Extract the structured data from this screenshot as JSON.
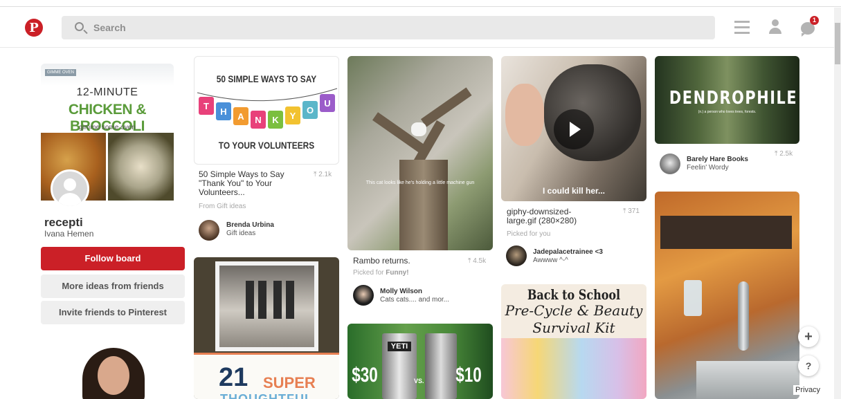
{
  "header": {
    "search_placeholder": "Search",
    "notification_count": "1"
  },
  "board": {
    "cover_badge": "GIMME OVEN",
    "cover_line1": "12-MINUTE",
    "cover_line2": "CHICKEN & BROCCOLI",
    "cover_line3": "gimme some oven",
    "title": "recepti",
    "owner": "Ivana Hemen",
    "follow_label": "Follow board",
    "more_label": "More ideas from friends",
    "invite_label": "Invite friends to Pinterest"
  },
  "pins": {
    "thanks": {
      "title_top": "50 SIMPLE WAYS TO SAY",
      "tags": [
        "T",
        "H",
        "A",
        "N",
        "K",
        "Y",
        "O",
        "U"
      ],
      "title_bottom": "TO YOUR VOLUNTEERS",
      "description": "50 Simple Ways to Say \"Thank You\" to Your Volunteers...",
      "count": "⤒ 2.1k",
      "source": "From Gift ideas",
      "user": "Brenda Urbina",
      "user_sub": "Gift ideas"
    },
    "candles": {
      "num": "21",
      "word1": "SUPER",
      "word2": "THOUGHTFUL"
    },
    "tree": {
      "caption": "This cat looks like he's holding a little machine gun",
      "description": "Rambo returns.",
      "count": "⤒ 4.5k",
      "picked_prefix": "Picked for ",
      "picked_topic": "Funny!",
      "user": "Molly Wilson",
      "user_sub": "Cats cats.... and mor..."
    },
    "yeti": {
      "price_left": "$30",
      "vs": "VS.",
      "price_right": "$10",
      "cup_label": "YETI"
    },
    "cat_video": {
      "caption": "I could kill her...",
      "description": "giphy-downsized-large.gif (280×280)",
      "count": "⤒ 371",
      "picked": "Picked for you",
      "user": "Jadepalacetrainee <3",
      "user_sub": "Awwww ^-^"
    },
    "school": {
      "line1": "Back to School",
      "line2": "Pre-Cycle & Beauty",
      "line3": "Survival Kit"
    },
    "forest": {
      "title": "DENDROPHILE",
      "subtitle": "(n.) a person who loves trees, forests.",
      "count": "⤒ 2.5k",
      "user": "Barely Hare Books",
      "user_sub": "Feelin' Wordy"
    }
  },
  "floating": {
    "plus": "+",
    "help": "?",
    "privacy": "Privacy"
  },
  "colors": {
    "brand_red": "#cb2027",
    "button_grey": "#efefef"
  }
}
